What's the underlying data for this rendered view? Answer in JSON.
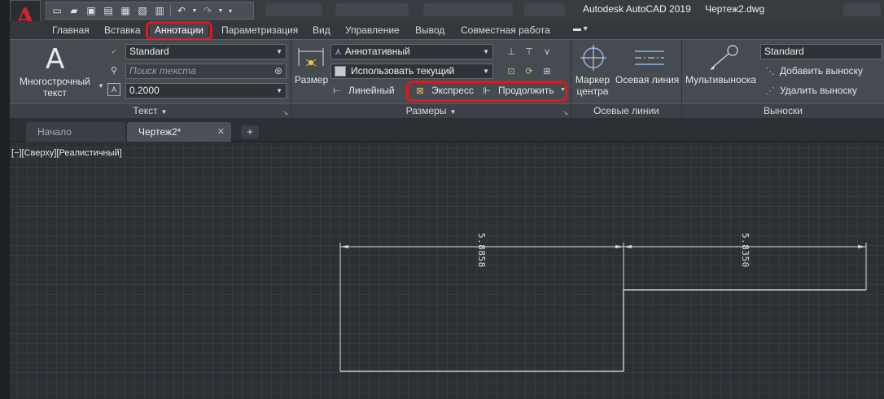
{
  "titlebar": {
    "app_title": "Autodesk AutoCAD 2019",
    "file_name": "Чертеж2.dwg"
  },
  "ribbon_tabs": [
    {
      "label": "Главная"
    },
    {
      "label": "Вставка"
    },
    {
      "label": "Аннотации"
    },
    {
      "label": "Параметризация"
    },
    {
      "label": "Вид"
    },
    {
      "label": "Управление"
    },
    {
      "label": "Вывод"
    },
    {
      "label": "Совместная работа"
    }
  ],
  "text_panel": {
    "big_button_line1": "Многострочный",
    "big_button_line2": "текст",
    "style_value": "Standard",
    "search_placeholder": "Поиск текста",
    "height_value": "0.2000",
    "footer": "Текст"
  },
  "dimensions_panel": {
    "size_label": "Размер",
    "style_value": "Аннотативный",
    "layer_value": "Использовать текущий",
    "linear_label": "Линейный",
    "express_label": "Экспресс",
    "continue_label": "Продолжить",
    "footer": "Размеры"
  },
  "centerlines_panel": {
    "center_mark_line1": "Маркер",
    "center_mark_line2": "центра",
    "centerline_label": "Осевая линия",
    "footer": "Осевые линии"
  },
  "leaders_panel": {
    "multileader_label": "Мультивыноска",
    "style_value": "Standard",
    "add_leader_label": "Добавить выноску",
    "remove_leader_label": "Удалить выноску",
    "footer": "Выноски"
  },
  "doc_tabs": [
    {
      "label": "Начало"
    },
    {
      "label": "Чертеж2*"
    }
  ],
  "viewport_label": "[−][Сверху][Реалистичный]",
  "dimensions": [
    {
      "text": "5.8858"
    },
    {
      "text": "5.8350"
    }
  ],
  "colors": {
    "highlight": "#e01818",
    "app_logo": "#d1232a",
    "background": "#2c2f34"
  }
}
